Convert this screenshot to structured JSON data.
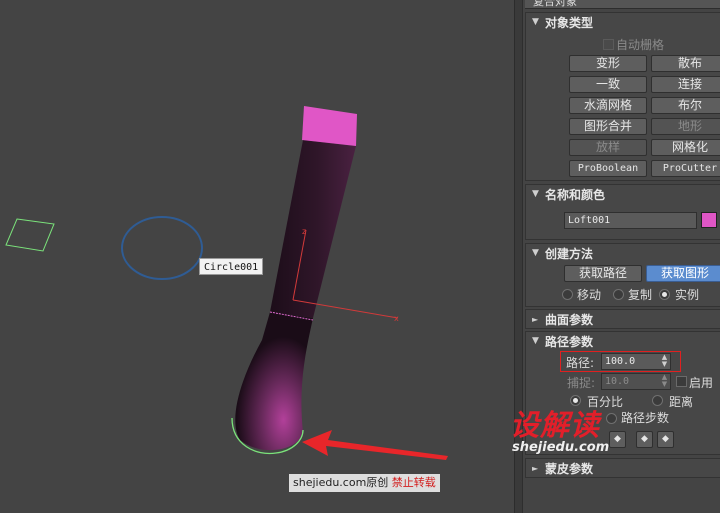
{
  "colors": {
    "background": "#444444",
    "loft_magenta": "#e056c6",
    "loft_dark": "#2b1526",
    "circle_blue": "#2f5c94",
    "selection_green": "#7be37b",
    "axis_red": "#d23a3a",
    "annotation_red": "#e8262a",
    "active_button": "#5b8ccf"
  },
  "viewport": {
    "object_label": "Circle001",
    "credit_site": "shejiedu.com",
    "credit_original": "原创",
    "credit_forbidden": "禁止转载"
  },
  "panel": {
    "top_strip_title": "复合对象",
    "object_type": {
      "title": "对象类型",
      "autogrid_label": "自动栅格",
      "buttons": {
        "morph": "变形",
        "scatter": "散布",
        "conform": "一致",
        "connect": "连接",
        "blobmesh": "水滴网格",
        "boolean": "布尔",
        "shapemerge": "图形合并",
        "terrain": "地形",
        "loft": "放样",
        "mesher": "网格化",
        "proboolean": "ProBoolean",
        "procutter": "ProCutter"
      }
    },
    "name_color": {
      "title": "名称和颜色",
      "name_value": "Loft001",
      "swatch_color": "#e056c6"
    },
    "creation_method": {
      "title": "创建方法",
      "get_path": "获取路径",
      "get_shape": "获取图形",
      "radio_move": "移动",
      "radio_copy": "复制",
      "radio_instance": "实例"
    },
    "surface_params": {
      "title": "曲面参数"
    },
    "path_params": {
      "title": "路径参数",
      "path_label": "路径:",
      "path_value": "100.0",
      "snap_label": "捕捉:",
      "snap_value": "10.0",
      "enable_label": "启用",
      "percentage_label": "百分比",
      "distance_label": "距离",
      "path_steps_label": "路径步数"
    },
    "skin_params": {
      "title": "蒙皮参数"
    },
    "logo_text": "设解读",
    "logo_url": "shejiedu.com"
  }
}
